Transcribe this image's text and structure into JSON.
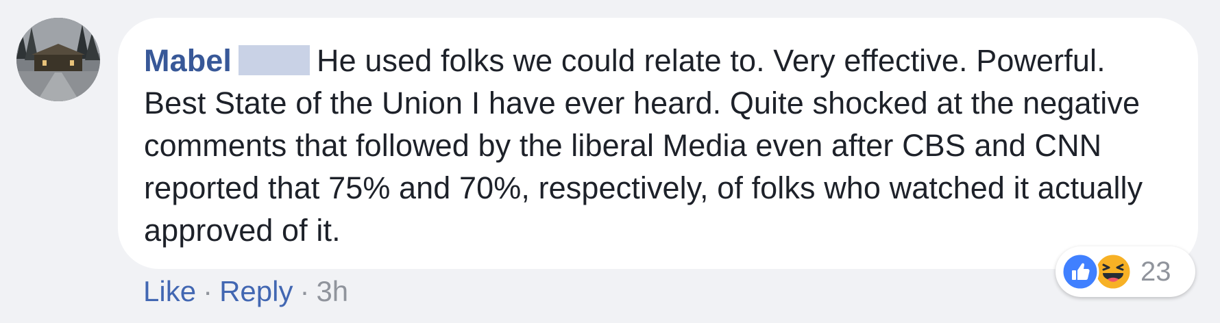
{
  "comment": {
    "author": "Mabel",
    "text": "He used folks we could relate to. Very effective. Powerful. Best State of the Union I have ever heard. Quite shocked at the negative comments that followed by the liberal Media even after CBS and CNN reported that 75% and 70%, respectively, of folks who watched it actually approved of it.",
    "actions": {
      "like_label": "Like",
      "reply_label": "Reply",
      "separator": "·",
      "timestamp": "3h"
    },
    "reactions": {
      "icons": [
        "like-icon",
        "haha-icon"
      ],
      "count": "23"
    }
  },
  "colors": {
    "page_background": "#f1f2f5",
    "bubble_background": "#ffffff",
    "author_link": "#385898",
    "action_link": "#4267b2",
    "muted_text": "#90949c",
    "body_text": "#1d2129",
    "like_blue": "#4080ff",
    "haha_yellow": "#f7b125"
  }
}
